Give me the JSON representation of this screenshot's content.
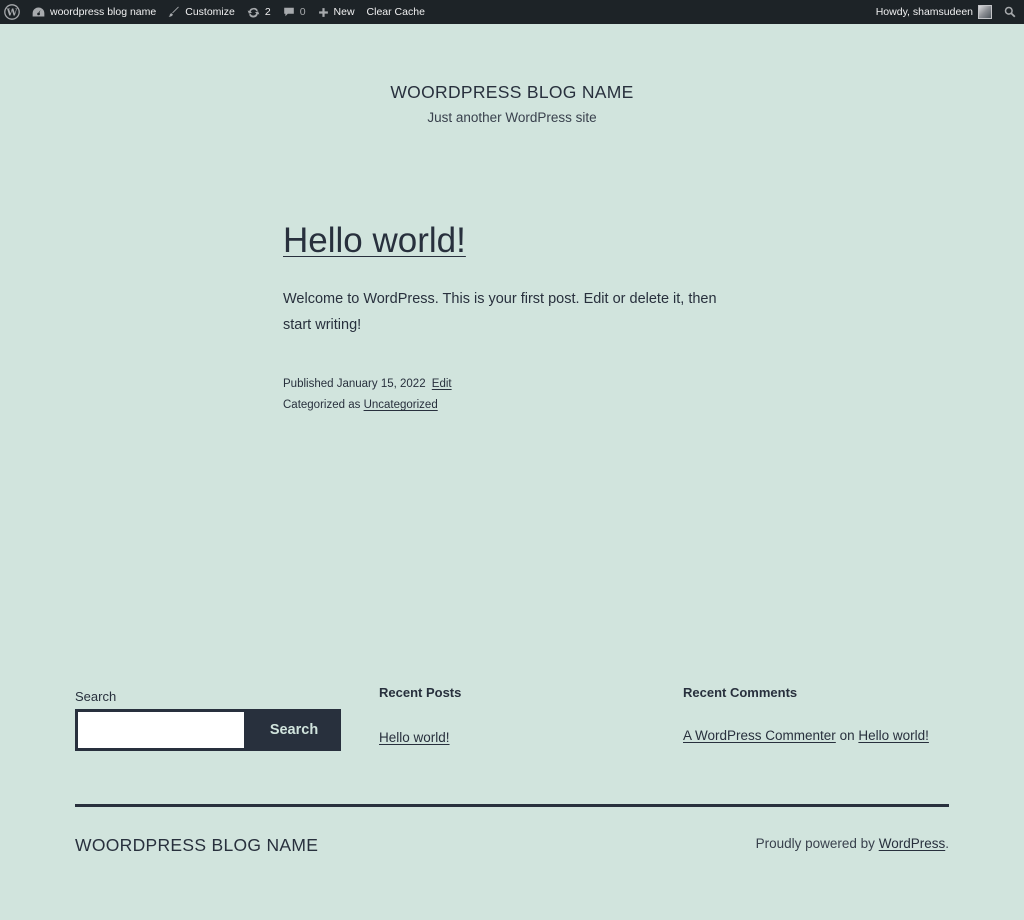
{
  "adminbar": {
    "site_name": "woordpress blog name",
    "customize": "Customize",
    "updates_count": "2",
    "comments_count": "0",
    "new_label": "New",
    "clear_cache": "Clear Cache",
    "howdy": "Howdy, shamsudeen"
  },
  "header": {
    "title": "WOORDPRESS BLOG NAME",
    "tagline": "Just another WordPress site"
  },
  "post": {
    "title": "Hello world!",
    "content": "Welcome to WordPress. This is your first post. Edit or delete it, then start writing!",
    "published_prefix": "Published",
    "date": "January 15, 2022",
    "edit_label": "Edit",
    "categorized_prefix": "Categorized as",
    "category": "Uncategorized"
  },
  "widgets": {
    "search": {
      "label": "Search",
      "placeholder": "",
      "button": "Search"
    },
    "recent_posts": {
      "heading": "Recent Posts",
      "items": [
        "Hello world!"
      ]
    },
    "recent_comments": {
      "heading": "Recent Comments",
      "author": "A WordPress Commenter",
      "on": "on",
      "post": "Hello world!"
    }
  },
  "footer": {
    "site_title": "WOORDPRESS BLOG NAME",
    "powered_prefix": "Proudly powered by",
    "powered_link": "WordPress",
    "powered_suffix": "."
  }
}
